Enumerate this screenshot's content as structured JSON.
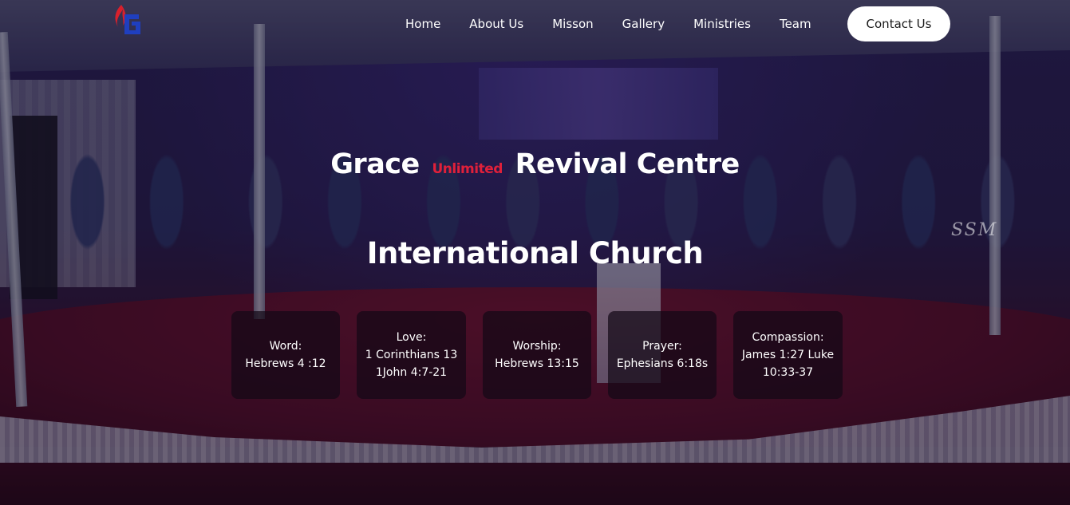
{
  "nav": {
    "logo_alt": "Grace Unlimited logo",
    "items": [
      {
        "label": "Home"
      },
      {
        "label": "About Us"
      },
      {
        "label": "Misson"
      },
      {
        "label": "Gallery"
      },
      {
        "label": "Ministries"
      },
      {
        "label": "Team"
      }
    ],
    "contact_label": "Contact Us"
  },
  "hero": {
    "title_part1": "Grace",
    "title_tag": "Unlimited",
    "title_part2": "Revival Centre",
    "title_line2": "International Church",
    "watermark": "SSM"
  },
  "cards": [
    {
      "heading": "Word:",
      "lines": [
        "Hebrews 4 :12"
      ]
    },
    {
      "heading": "Love:",
      "lines": [
        "1 Corinthians 13",
        "1John 4:7-21"
      ]
    },
    {
      "heading": "Worship:",
      "lines": [
        "Hebrews 13:15"
      ]
    },
    {
      "heading": "Prayer:",
      "lines": [
        "Ephesians 6:18s"
      ]
    },
    {
      "heading": "Compassion:",
      "lines": [
        "James 1:27 Luke",
        "10:33-37"
      ]
    }
  ],
  "colors": {
    "accent_red": "#e0203a",
    "logo_blue": "#1f3fbf",
    "logo_flame": "#d8202c",
    "button_bg": "#ffffff"
  }
}
